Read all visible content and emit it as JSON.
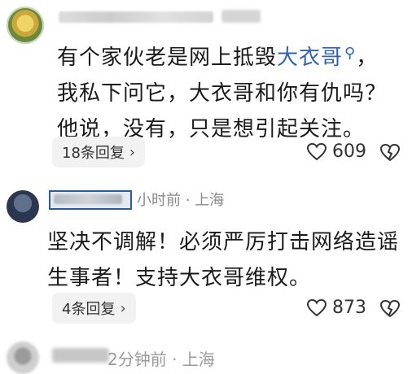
{
  "comments": [
    {
      "text_before": "有个家伙老是网上抵毁",
      "link": "大衣哥",
      "link_icon": "search-icon",
      "text_after": "，我私下问它，大衣哥和你有仇吗？他说，没有，只是想引起关注。",
      "replies_label": "18条回复",
      "likes": "609"
    },
    {
      "meta": "小时前 · 上海",
      "text": "坚决不调解！必须严厉打击网络造谣生事者！支持大衣哥维权。",
      "replies_label": "4条回复",
      "likes": "873"
    },
    {
      "meta_visible": "2分钟前 · 上海"
    }
  ],
  "colors": {
    "link": "#2f62b5",
    "meta": "#8a8a8a",
    "pill_bg": "#f2f2f2"
  }
}
